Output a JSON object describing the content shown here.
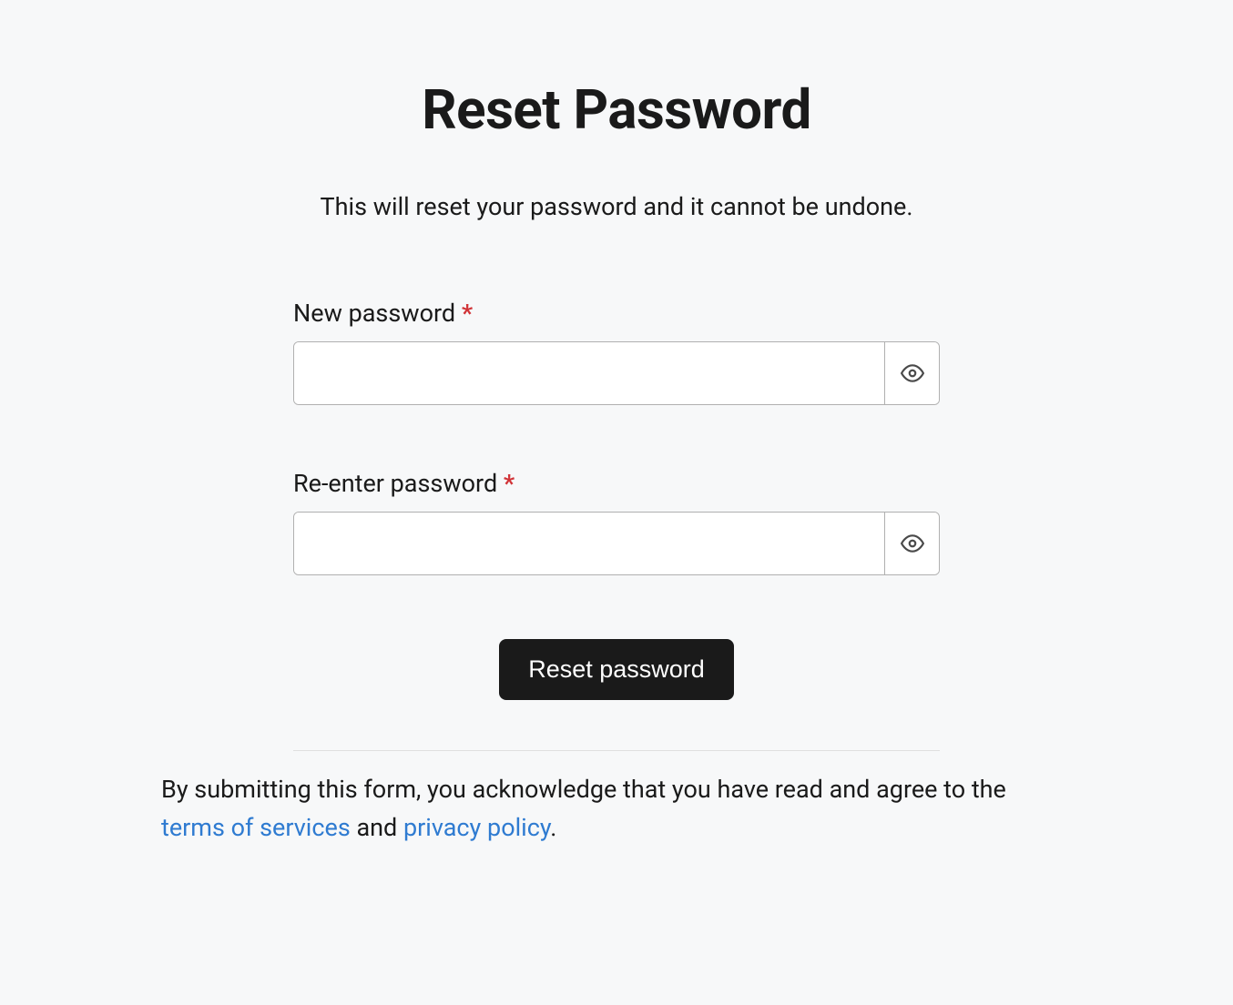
{
  "heading": "Reset Password",
  "subheading": "This will reset your password and it cannot be undone.",
  "form": {
    "new_password": {
      "label": "New password",
      "required_marker": "*",
      "value": ""
    },
    "reenter_password": {
      "label": "Re-enter password",
      "required_marker": "*",
      "value": ""
    },
    "submit_label": "Reset password"
  },
  "disclaimer": {
    "prefix": "By submitting this form, you acknowledge that you have read and agree to the ",
    "terms_link": "terms of services",
    "middle": " and ",
    "privacy_link": "privacy policy",
    "suffix": "."
  }
}
